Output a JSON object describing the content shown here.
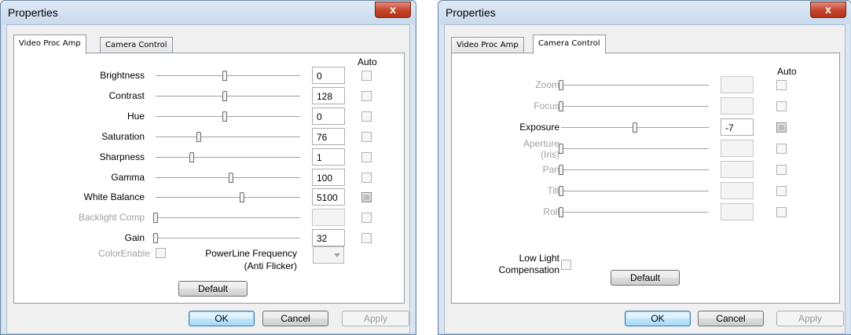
{
  "left": {
    "title": "Properties",
    "close": "x",
    "tabs": [
      "Video Proc Amp",
      "Camera Control"
    ],
    "auto_label": "Auto",
    "rows": [
      {
        "label": "Brightness",
        "value": "0",
        "level": 0.48,
        "enabled": true,
        "auto": false
      },
      {
        "label": "Contrast",
        "value": "128",
        "level": 0.48,
        "enabled": true,
        "auto": false
      },
      {
        "label": "Hue",
        "value": "0",
        "level": 0.48,
        "enabled": true,
        "auto": false
      },
      {
        "label": "Saturation",
        "value": "76",
        "level": 0.3,
        "enabled": true,
        "auto": false
      },
      {
        "label": "Sharpness",
        "value": "1",
        "level": 0.25,
        "enabled": true,
        "auto": false
      },
      {
        "label": "Gamma",
        "value": "100",
        "level": 0.52,
        "enabled": true,
        "auto": false
      },
      {
        "label": "White Balance",
        "value": "5100",
        "level": 0.6,
        "enabled": true,
        "auto": true
      },
      {
        "label": "Backlight Comp",
        "value": "",
        "level": 0.0,
        "enabled": false,
        "auto": false
      },
      {
        "label": "Gain",
        "value": "32",
        "level": 0.0,
        "enabled": true,
        "auto": false
      }
    ],
    "color_enable": "ColorEnable",
    "powerline_1": "PowerLine Frequency",
    "powerline_2": "(Anti Flicker)",
    "default_btn": "Default",
    "ok": "OK",
    "cancel": "Cancel",
    "apply": "Apply"
  },
  "right": {
    "title": "Properties",
    "close": "x",
    "tabs": [
      "Video Proc Amp",
      "Camera Control"
    ],
    "auto_label": "Auto",
    "rows": [
      {
        "label": "Zoom",
        "value": "",
        "level": 0.0,
        "enabled": false,
        "auto": false
      },
      {
        "label": "Focus",
        "value": "",
        "level": 0.0,
        "enabled": false,
        "auto": false
      },
      {
        "label": "Exposure",
        "value": "-7",
        "level": 0.5,
        "enabled": true,
        "auto": true
      },
      {
        "label": "Aperture",
        "label2": "(Iris)",
        "value": "",
        "level": 0.0,
        "enabled": false,
        "auto": false
      },
      {
        "label": "Pan",
        "value": "",
        "level": 0.0,
        "enabled": false,
        "auto": false
      },
      {
        "label": "Tilt",
        "value": "",
        "level": 0.0,
        "enabled": false,
        "auto": false
      },
      {
        "label": "Roll",
        "value": "",
        "level": 0.0,
        "enabled": false,
        "auto": false
      }
    ],
    "low_light_1": "Low Light",
    "low_light_2": "Compensation",
    "default_btn": "Default",
    "ok": "OK",
    "cancel": "Cancel",
    "apply": "Apply"
  }
}
